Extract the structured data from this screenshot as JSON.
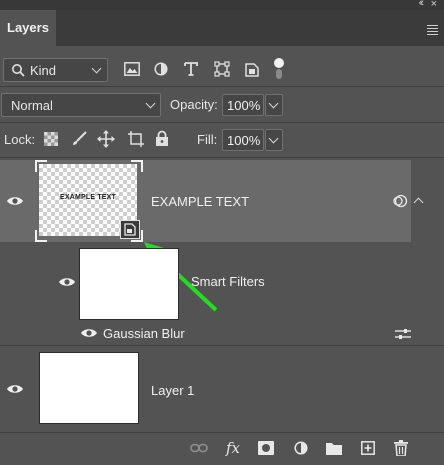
{
  "panel": {
    "tab_label": "Layers",
    "filter": {
      "kind_label": "Kind"
    },
    "blend_mode": "Normal",
    "opacity_label": "Opacity:",
    "opacity_value": "100%",
    "lock_label": "Lock:",
    "fill_label": "Fill:",
    "fill_value": "100%"
  },
  "layers": {
    "smart_object": {
      "name": "EXAMPLE TEXT",
      "thumb_text": "EXAMPLE TEXT",
      "selected": true
    },
    "smart_filters": {
      "label": "Smart Filters",
      "filter_name": "Gaussian Blur"
    },
    "layer1": {
      "name": "Layer 1"
    }
  },
  "colors": {
    "selected_row": "#6a6a6a",
    "panel_bg": "#535353",
    "annotation_arrow": "#22dd22"
  },
  "icons": {
    "filter_icons": [
      "image-icon",
      "adjustment-icon",
      "type-icon",
      "shape-icon",
      "smart-object-icon",
      "toggle-dot-icon"
    ],
    "lock_icons": [
      "lock-transparent-icon",
      "lock-brush-icon",
      "lock-move-icon",
      "lock-artboard-icon",
      "lock-all-icon"
    ],
    "footer_icons": [
      "link-icon",
      "fx-icon",
      "mask-icon",
      "adjustment-layer-icon",
      "group-folder-icon",
      "new-layer-icon",
      "trash-icon"
    ]
  }
}
